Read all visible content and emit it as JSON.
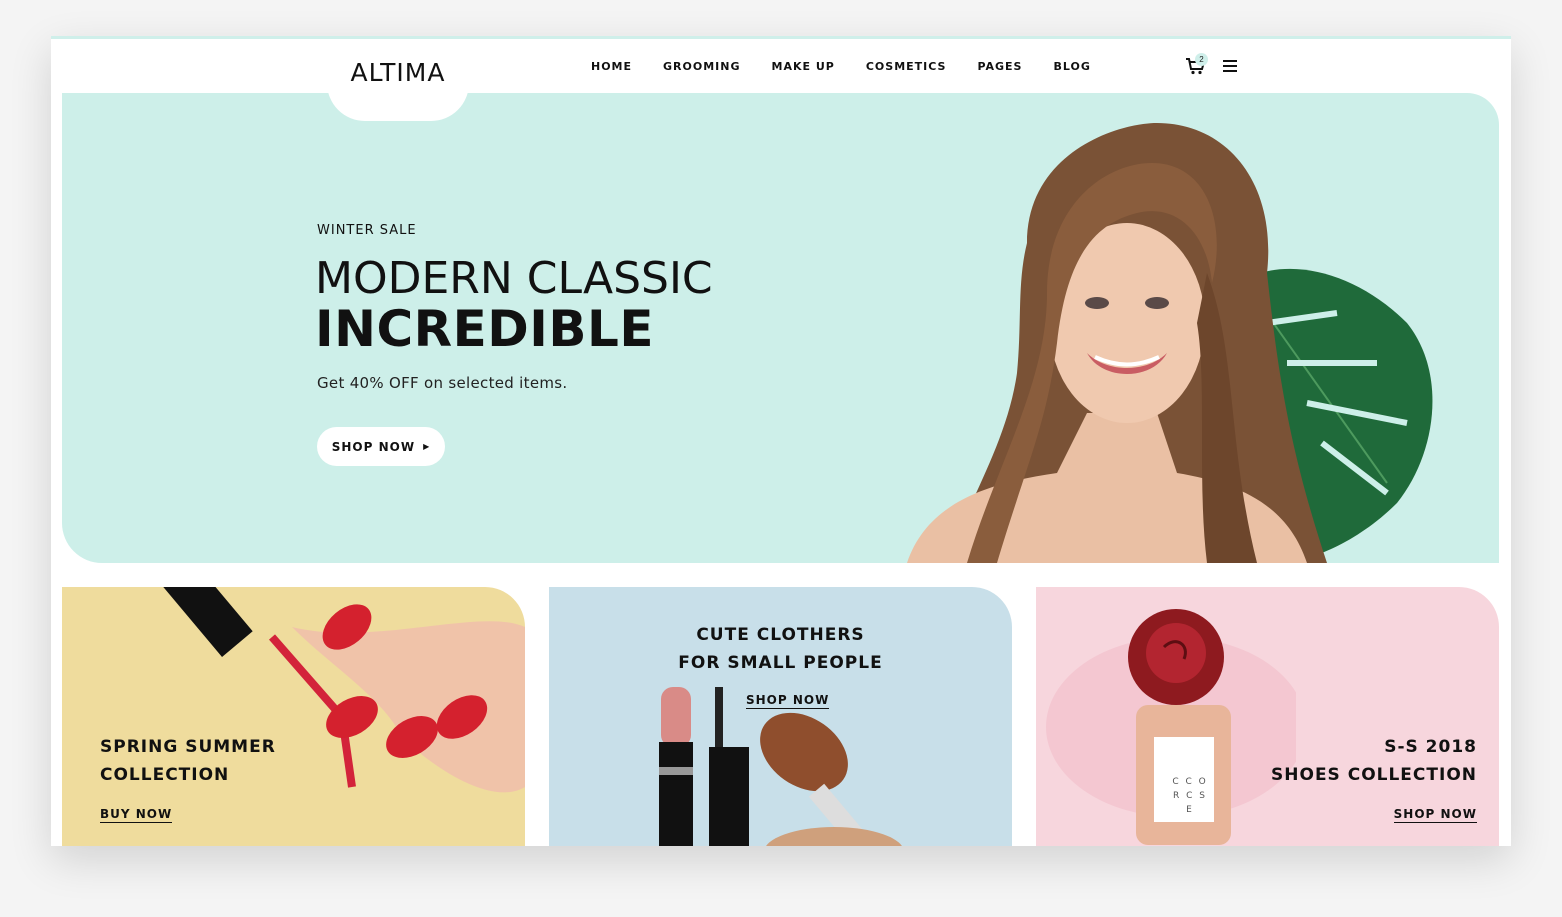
{
  "header": {
    "logo": "ALTIMA",
    "nav": [
      "HOME",
      "GROOMING",
      "MAKE UP",
      "COSMETICS",
      "PAGES",
      "BLOG"
    ],
    "cart_count": "2",
    "icons": [
      "cart-icon",
      "hamburger-menu-icon"
    ]
  },
  "hero": {
    "pretitle": "WINTER SALE",
    "title_line1": "MODERN CLASSIC",
    "title_line2": "INCREDIBLE",
    "subtitle": "Get 40% OFF on selected items.",
    "button": "SHOP NOW"
  },
  "banners": [
    {
      "line1": "SPRING SUMMER",
      "line2": "COLLECTION",
      "link": "BUY NOW"
    },
    {
      "line1": "CUTE CLOTHERS",
      "line2": "FOR SMALL PEOPLE",
      "link": "SHOP NOW"
    },
    {
      "line1": "S-S 2018",
      "line2": "SHOES COLLECTION",
      "link": "SHOP NOW"
    }
  ],
  "product_label": {
    "line1": "C C O",
    "line2": "R C S E"
  },
  "colors": {
    "mint": "#cdefe9",
    "yellow": "#efdc9d",
    "blue": "#c8dfe9",
    "pink": "#f7d6dd"
  }
}
